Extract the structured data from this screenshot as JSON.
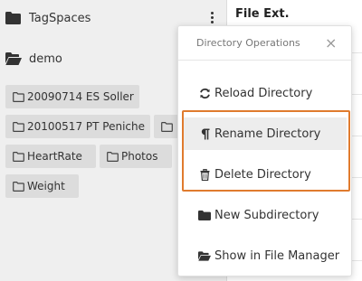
{
  "sidebar": {
    "location_name": "TagSpaces",
    "current_dir": "demo",
    "subfolders": [
      "20090714 ES Soller",
      "20100517 PT Peniche",
      "",
      "HeartRate",
      "Photos",
      "Weight"
    ]
  },
  "main": {
    "column_header": "File Ext."
  },
  "popup": {
    "title": "Directory Operations",
    "close_glyph": "×",
    "items": [
      {
        "label": "Reload Directory",
        "icon": "refresh-icon"
      },
      {
        "label": "Rename Directory",
        "icon": "paragraph-icon"
      },
      {
        "label": "Delete Directory",
        "icon": "trash-icon"
      },
      {
        "label": "New Subdirectory",
        "icon": "folder-icon"
      },
      {
        "label": "Show in File Manager",
        "icon": "folder-open-icon"
      }
    ]
  },
  "colors": {
    "highlight": "#e07b2e",
    "chip_bg": "#dcdcdc"
  }
}
